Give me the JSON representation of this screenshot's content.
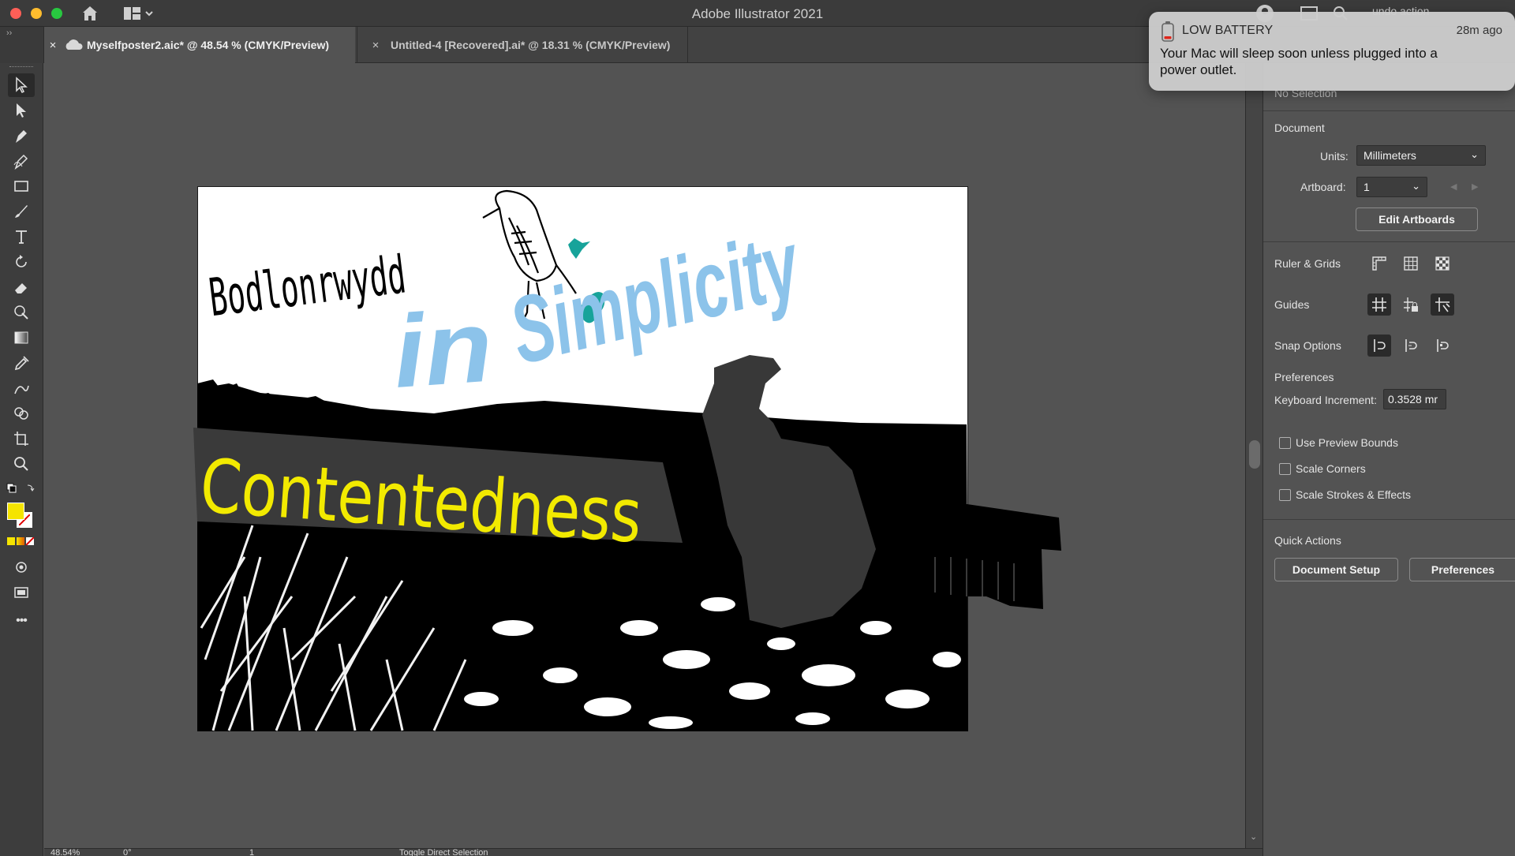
{
  "window": {
    "title": "Adobe Illustrator 2021",
    "search_text": "undo action"
  },
  "tabs": [
    {
      "label": "Myselfposter2.aic* @ 48.54 % (CMYK/Preview)",
      "active": true
    },
    {
      "label": "Untitled-4 [Recovered].ai* @ 18.31 % (CMYK/Preview)",
      "active": false
    }
  ],
  "toolbar": {
    "tools": [
      "selection-tool",
      "direct-selection-tool",
      "pen-tool",
      "curvature-tool",
      "rectangle-tool",
      "paintbrush-tool",
      "type-tool",
      "rotate-tool",
      "eraser-tool",
      "puppet-warp-tool",
      "gradient-tool",
      "eyedropper-tool",
      "blend-tool",
      "shape-builder-tool",
      "artboard-tool",
      "zoom-tool"
    ],
    "fill_color": "#f5e400",
    "more_label": "•••"
  },
  "artwork": {
    "title_welsh": "Bodlonrwydd",
    "title_in": "in",
    "title_simplicity": "Simplicity",
    "title_contentedness": "Contentedness",
    "colors": {
      "yellow": "#f2ea00",
      "blue": "#8cc3ea",
      "teal": "#17a39a",
      "grey": "#383838",
      "black": "#000000"
    }
  },
  "panel": {
    "selection_label": "No Selection",
    "document_title": "Document",
    "units_label": "Units:",
    "units_value": "Millimeters",
    "artboard_label": "Artboard:",
    "artboard_value": "1",
    "edit_artboards": "Edit Artboards",
    "ruler_grids": "Ruler & Grids",
    "guides": "Guides",
    "snap_options": "Snap Options",
    "preferences_title": "Preferences",
    "keyboard_increment_label": "Keyboard Increment:",
    "keyboard_increment_value": "0.3528 mr",
    "checkboxes": [
      "Use Preview Bounds",
      "Scale Corners",
      "Scale Strokes & Effects"
    ],
    "quick_actions": "Quick Actions",
    "document_setup": "Document Setup",
    "preferences_button": "Preferences"
  },
  "status": {
    "zoom": "48.54%",
    "rotation": "0°",
    "artboard": "1",
    "hint": "Toggle Direct Selection"
  },
  "notification": {
    "title": "LOW BATTERY",
    "time": "28m ago",
    "body": "Your Mac will sleep soon unless plugged into a power outlet."
  }
}
